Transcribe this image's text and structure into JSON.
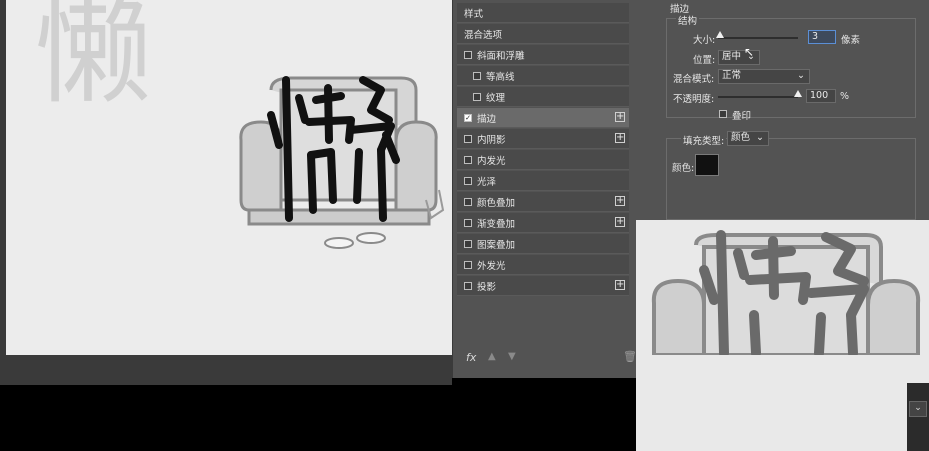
{
  "canvas": {
    "ghost_char": "懒"
  },
  "styles_panel": {
    "header": "样式",
    "items": [
      {
        "label": "混合选项",
        "checkbox": false,
        "checked": false,
        "plus": false,
        "indent": 0,
        "selected": false
      },
      {
        "label": "斜面和浮雕",
        "checkbox": true,
        "checked": false,
        "plus": false,
        "indent": 0,
        "selected": false
      },
      {
        "label": "等高线",
        "checkbox": true,
        "checked": false,
        "plus": false,
        "indent": 1,
        "selected": false
      },
      {
        "label": "纹理",
        "checkbox": true,
        "checked": false,
        "plus": false,
        "indent": 1,
        "selected": false
      },
      {
        "label": "描边",
        "checkbox": true,
        "checked": true,
        "plus": true,
        "indent": 0,
        "selected": true
      },
      {
        "label": "内阴影",
        "checkbox": true,
        "checked": false,
        "plus": true,
        "indent": 0,
        "selected": false
      },
      {
        "label": "内发光",
        "checkbox": true,
        "checked": false,
        "plus": false,
        "indent": 0,
        "selected": false
      },
      {
        "label": "光泽",
        "checkbox": true,
        "checked": false,
        "plus": false,
        "indent": 0,
        "selected": false
      },
      {
        "label": "颜色叠加",
        "checkbox": true,
        "checked": false,
        "plus": true,
        "indent": 0,
        "selected": false
      },
      {
        "label": "渐变叠加",
        "checkbox": true,
        "checked": false,
        "plus": true,
        "indent": 0,
        "selected": false
      },
      {
        "label": "图案叠加",
        "checkbox": true,
        "checked": false,
        "plus": false,
        "indent": 0,
        "selected": false
      },
      {
        "label": "外发光",
        "checkbox": true,
        "checked": false,
        "plus": false,
        "indent": 0,
        "selected": false
      },
      {
        "label": "投影",
        "checkbox": true,
        "checked": false,
        "plus": true,
        "indent": 0,
        "selected": false
      }
    ],
    "footer_fx": "fx"
  },
  "stroke": {
    "title": "描边",
    "structure_label": "结构",
    "size_label": "大小:",
    "size_value": "3",
    "size_unit": "像素",
    "size_fraction": 0.02,
    "position_label": "位置:",
    "position_value": "居中",
    "blend_label": "混合模式:",
    "blend_value": "正常",
    "opacity_label": "不透明度:",
    "opacity_value": "100",
    "opacity_unit": "%",
    "opacity_fraction": 1.0,
    "overprint_label": "叠印",
    "fill_type_label": "填充类型:",
    "fill_type_value": "颜色",
    "color_label": "颜色:",
    "color_swatch": "#111111"
  },
  "colors": {
    "accent_field": "#5b8fd6",
    "stroke_color": "#111111"
  }
}
